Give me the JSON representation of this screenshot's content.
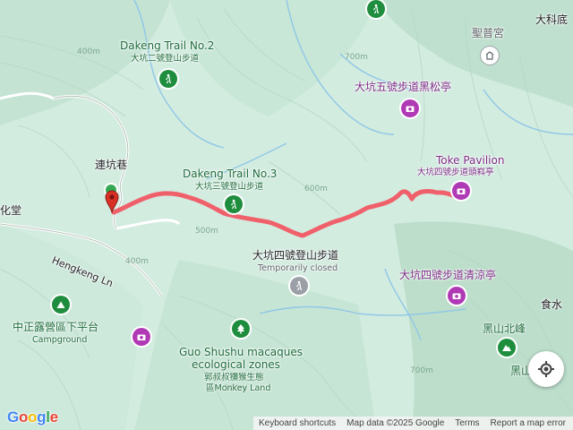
{
  "map": {
    "labels": {
      "dakeng_trail_2": "Dakeng Trail No.2",
      "dakeng_trail_2_zh": "大坑二號登山步道",
      "dakeng_trail_3": "Dakeng Trail No.3",
      "dakeng_trail_3_zh": "大坑三號登山步道",
      "lianken_temple": "連坑巷",
      "huatang": "化堂",
      "shengpu_temple": "聖普宮",
      "dakeng_trail_5_pavilion": "大坑五號步道黑松亭",
      "toke_pavilion": "Toke Pavilion",
      "toke_pavilion_zh": "大坑四號步道頭嵙亭",
      "dakeng_trail_4_zh": "大坑四號登山步道",
      "temporarily_closed": "Temporarily closed",
      "qingliang_pavilion": "大坑四號步道清涼亭",
      "hengkeng_ln": "Hengkeng Ln",
      "zhongzheng_camp_zh": "中正露營區下平台",
      "campground": "Campground",
      "guo_shushu_1": "Guo Shushu macaques",
      "guo_shushu_2": "ecological zones",
      "guo_shushu_zh": "郭叔叔獼猴生態",
      "monkey_land": "區Monkey Land",
      "heishan_north": "黑山北峰",
      "heishan": "黑山",
      "shishui": "食水",
      "dakeng_di": "大科底"
    },
    "contours": {
      "c400a": "400m",
      "c400b": "400m",
      "c500": "500m",
      "c600": "600m",
      "c700a": "700m",
      "c700b": "700m",
      "c500b": "500m"
    }
  },
  "attribution": {
    "google": "Google",
    "keyboard_shortcuts": "Keyboard shortcuts",
    "map_data": "Map data ©2025 Google",
    "terms": "Terms",
    "report": "Report a map error"
  },
  "colors": {
    "route": "#f0606b",
    "start_marker": "#34a853",
    "end_marker": "#d93025",
    "green_poi": "#1e8e3e",
    "purple_poi": "#b03ab5"
  },
  "icons": [
    "hiking-icon",
    "camera-icon",
    "tree-icon",
    "tent-icon",
    "temple-icon",
    "locate-icon"
  ]
}
